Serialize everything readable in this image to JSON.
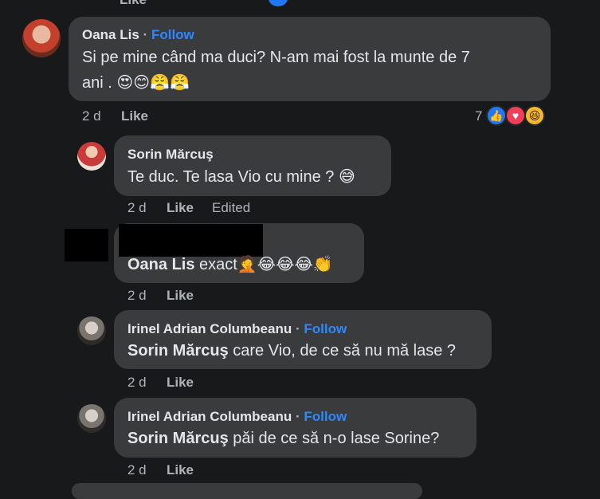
{
  "comments": [
    {
      "author": "Oana Lis",
      "follow_label": "Follow",
      "text_line1": "Si pe mine când ma duci? N-am mai fost la munte de 7",
      "text_line2": "ani .",
      "emojis": "😍😊😤😤",
      "time": "2 d",
      "like_label": "Like",
      "reaction_count": "7"
    },
    {
      "author": "Sorin Mărcuş",
      "text": "Te duc. Te lasa Vio cu mine ?",
      "emojis": "😅",
      "time": "2 d",
      "like_label": "Like",
      "edited_label": "Edited"
    },
    {
      "mention": "Oana Lis",
      "text": " exact",
      "emojis": "🤦😂😂😂👏",
      "time": "2 d",
      "like_label": "Like"
    },
    {
      "author": "Irinel Adrian Columbeanu",
      "follow_label": "Follow",
      "mention": "Sorin Mărcuş",
      "text": " care Vio, de ce să nu mă lase ?",
      "time": "2 d",
      "like_label": "Like"
    },
    {
      "author": "Irinel Adrian Columbeanu",
      "follow_label": "Follow",
      "mention": "Sorin Mărcuş",
      "text": " păi de ce să n-o lase Sorine?",
      "time": "2 d",
      "like_label": "Like"
    }
  ],
  "separator": "·",
  "icons": {
    "like_reaction": "like-icon",
    "love_reaction": "love-icon",
    "haha_reaction": "haha-icon"
  },
  "colors": {
    "background": "#18191a",
    "bubble": "#3a3b3c",
    "follow": "#2d88ff",
    "like_blue": "#2078f4",
    "love_red": "#f33e58"
  }
}
